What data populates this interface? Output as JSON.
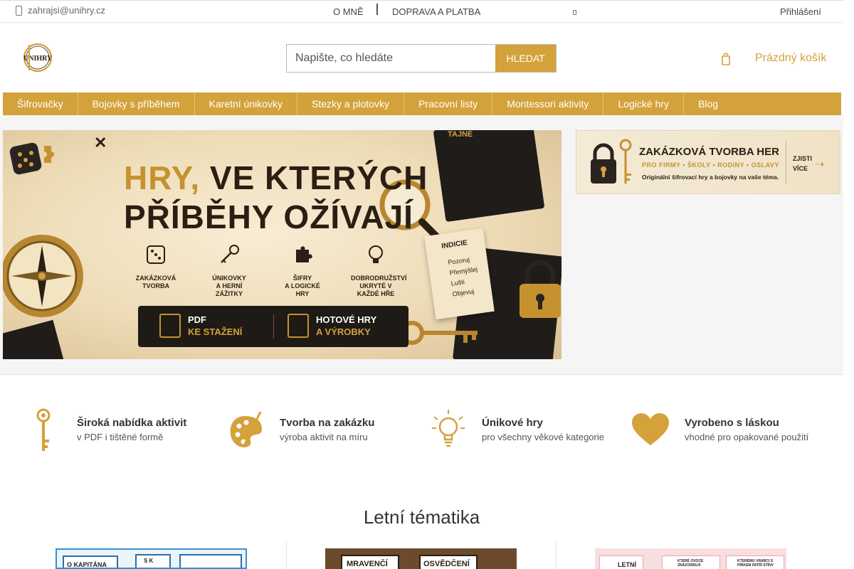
{
  "topbar": {
    "email": "zahrajsi@unihry.cz",
    "links": [
      "O MNĚ",
      "DOPRAVA A PLATBA"
    ],
    "login": "Přihlášení"
  },
  "header": {
    "logo_text": "UNIHRY",
    "search_placeholder": "Napište, co hledáte",
    "search_button": "HLEDAT",
    "cart_label": "Prázdný košík"
  },
  "nav": {
    "items": [
      "Šifrovačky",
      "Bojovky s příběhem",
      "Karetní únikovky",
      "Stezky a plotovky",
      "Pracovní listy",
      "Montessori aktivity",
      "Logické hry",
      "Blog"
    ]
  },
  "hero": {
    "title_accent": "HRY,",
    "title_line1_rest": " VE KTERÝCH",
    "title_line2": "PŘÍBĚHY OŽÍVAJÍ",
    "features": [
      {
        "line1": "ZAKÁZKOVÁ",
        "line2": "TVORBA",
        "icon": "dice-icon"
      },
      {
        "line1": "ÚNIKOVKY",
        "line2": "A HERNÍ ZÁŽITKY",
        "icon": "key-icon"
      },
      {
        "line1": "ŠIFRY",
        "line2": "A LOGICKÉ HRY",
        "icon": "puzzle-icon"
      },
      {
        "line1": "DOBRODRUŽSTVÍ",
        "line2": "UKRYTÉ V KAŽDÉ HŘE",
        "icon": "bulb-icon"
      }
    ],
    "cta_left_top": "PDF",
    "cta_left_bottom": "KE STAŽENÍ",
    "cta_right_top": "HOTOVÉ HRY",
    "cta_right_bottom": "A VÝROBKY",
    "card_title": "INDICIE",
    "card_items": [
      "Pozoruj",
      "Přemýšlej",
      "Lušti",
      "Objevuj"
    ],
    "book_label": "TAJNÉ"
  },
  "side_banner": {
    "title": "ZAKÁZKOVÁ TVORBA HER",
    "subtitle": "PRO FIRMY • ŠKOLY • RODINY • OSLAVY",
    "subtitle2": "Originální šifrovací hry a bojovky na vaše téma.",
    "cta_line1": "ZJISTI",
    "cta_line2": "VÍCE"
  },
  "features": [
    {
      "title": "Široká nabídka aktivit",
      "subtitle": "v PDF i tištěné formě",
      "icon": "key-icon"
    },
    {
      "title": "Tvorba na zakázku",
      "subtitle": "výroba aktivit na míru",
      "icon": "palette-icon"
    },
    {
      "title": "Únikové hry",
      "subtitle": "pro všechny věkové kategorie",
      "icon": "lightbulb-icon"
    },
    {
      "title": "Vyrobeno s láskou",
      "subtitle": "vhodné pro opakované použití",
      "icon": "heart-icon"
    }
  ],
  "section": {
    "title": "Letní tématika"
  },
  "products": [
    {
      "label1": "O KAPITÁNA",
      "label2": "S K"
    },
    {
      "label1": "MRAVENČÍ",
      "label2": "OSVĚDČENÍ"
    },
    {
      "label1": "LETNÍ",
      "label2": "KTERÉ OVOCE ZNÁZORŇUJÍ",
      "label3": "KTERÉMU VRABCI S PÍRKEM PATŘÍ STÍNY"
    }
  ],
  "colors": {
    "accent": "#d4a23b",
    "text": "#333333"
  }
}
